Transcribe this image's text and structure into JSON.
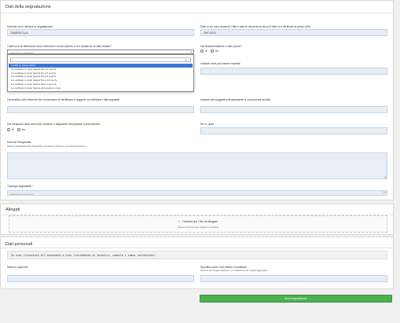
{
  "report": {
    "title": "Dati della segnalazione",
    "company_label": "Azienda cui si riferisce la segnalazione",
    "company_value": "ZANARDI S.p.A.",
    "date_label": "Data in cui sono avvenuti i fatti e data di decorrenza da cui il fatto si è verificato la prima volta",
    "date_value": "06/07/2023",
    "facts_label": "I fatti cui si fa riferimento sono avvenuti in modo ripetuto o si è trattato di un fatto isolato?",
    "facts_placeholder": "Seleziona un elemento",
    "facts_options": [
      "si tratta un evento isolato",
      "si è verificato in modo ripetuto fino a 3 mesi fa",
      "si è verificato in modo ripetuto fino a 6 mesi fa",
      "si è verificato in modo ripetuto fino a 9 mesi fa",
      "si è verificato in modo ripetuto fino a 12 mesi fa",
      "si è verificato in modo ripetuto oltre un anno fa",
      "si è verificato in modo ripetuto ed è ancora in corso"
    ],
    "docs_label": "Hai documentazione o altre prove?",
    "yes_label": "Sì",
    "no_label": "No",
    "where_label": "Indicare dove può essere reperita",
    "other_elements_label": "Generalità o altri elementi che consentano di identificare il soggetto cui attribuire i fatti segnalati",
    "other_subjects_label": "Indicare altri soggetti potenzialmente a conoscenza dei fatti",
    "prior_action_label": "Hai intrapreso altre azioni per risolvere o segnalare l'irregolarità in precedenza?",
    "which_label": "Se sì, quali",
    "describe_label": "Descrivi l'irregolarità",
    "describe_hint": "Descrivi dettagliatamente l'irregolarità, il contesto le persone e gli eventuali testimoni",
    "type_label": "Tipologia segnalante",
    "type_required": "*",
    "type_placeholder": "Seleziona un elemento"
  },
  "attachments": {
    "title": "Allegati",
    "drop_text": "Trascina qui i file da allegare",
    "drop_hint": "(Oppure clicca qui per sfogliare le cartelle)",
    "upload_arrow": "»"
  },
  "personal": {
    "title": "Dati personali",
    "notice": "Se vuoi rinunciare all'anonimato o stai richiedendo un incontro, compila i campi sottostanti.",
    "name_label": "Nome e cognome",
    "contact_label": "Specifica come vuoi essere ricontattato",
    "contact_hint": "Scrivi un tuo recapito telefonico o un indirizzo email a quale raggiungerti"
  },
  "submit_label": "Invia segnalazione",
  "colors": {
    "accent": "#4caf50",
    "field_bg": "#e7eef6",
    "option_selected": "#3875d7"
  }
}
